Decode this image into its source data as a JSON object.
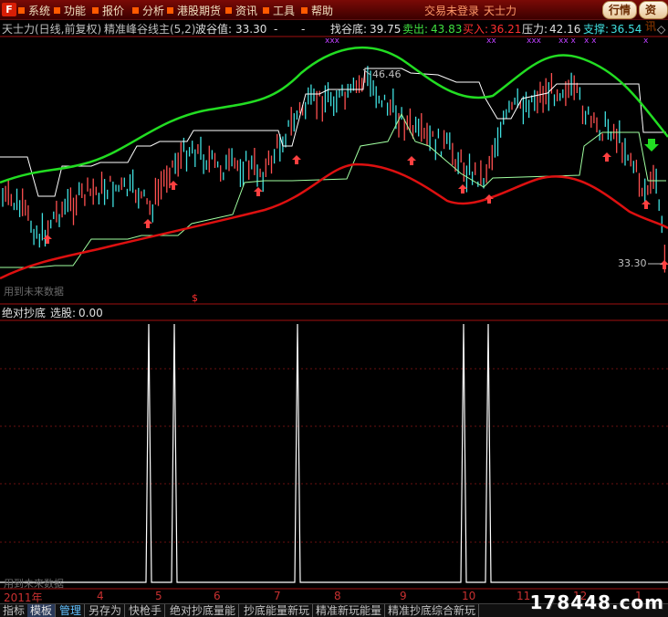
{
  "menubar": {
    "logo": "F",
    "items": [
      "系统",
      "功能",
      "报价",
      "分析",
      "港股期货",
      "资讯",
      "工具",
      "帮助"
    ],
    "trade_status": "交易未登录",
    "app_name": "天士力",
    "btn_quote": "行情",
    "btn_info": "资讯"
  },
  "main_panel": {
    "title": "天士力(日线,前复权)",
    "indicator": "精准峰谷线主(5,2)",
    "wave_label": "波谷值:",
    "wave_value": "33.30",
    "dash": "-",
    "bottom_label": "找谷底:",
    "bottom_value": "39.75",
    "sell_label": "卖出:",
    "sell_value": "43.83",
    "buy_label": "买入:",
    "buy_value": "36.21",
    "pressure_label": "压力:",
    "pressure_value": "42.16",
    "support_label": "支撑:",
    "support_value": "36.54",
    "high_mark": "46.46",
    "low_mark": "33.30",
    "future_data": "用到未来数据",
    "dollar_mark": "$",
    "colors": {
      "green_line": "#22dd22",
      "red_line": "#dd1010",
      "white_line": "#ffffff",
      "up_candle": "#ff5050",
      "down_candle": "#40e0e0"
    }
  },
  "sub_panel": {
    "title": "绝对抄底",
    "pick_label": "选股:",
    "pick_value": "0.00",
    "future_data": "用到未来数据"
  },
  "date_axis": {
    "year": "2011年",
    "months": [
      "4",
      "5",
      "6",
      "7",
      "8",
      "9",
      "10",
      "11",
      "12",
      "1"
    ]
  },
  "tabs": [
    "指标",
    "模板",
    "管理",
    "另存为",
    "快枪手",
    "绝对抄底量能",
    "抄底能量新玩",
    "精准新玩能量",
    "精准抄底综合新玩"
  ],
  "site_mark": "178448.com"
}
